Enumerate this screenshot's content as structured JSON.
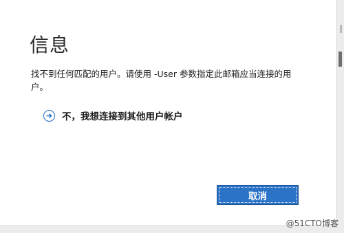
{
  "dialog": {
    "title": "信息",
    "message": "找不到任何匹配的用户。请使用 -User 参数指定此邮箱应当连接的用户。",
    "option_label": "不，我想连接到其他用户帐户",
    "option_icon": "arrow-right-circle-icon",
    "cancel_label": "取消",
    "accent_color": "#2a73c7"
  },
  "watermark": "@51CTO博客"
}
